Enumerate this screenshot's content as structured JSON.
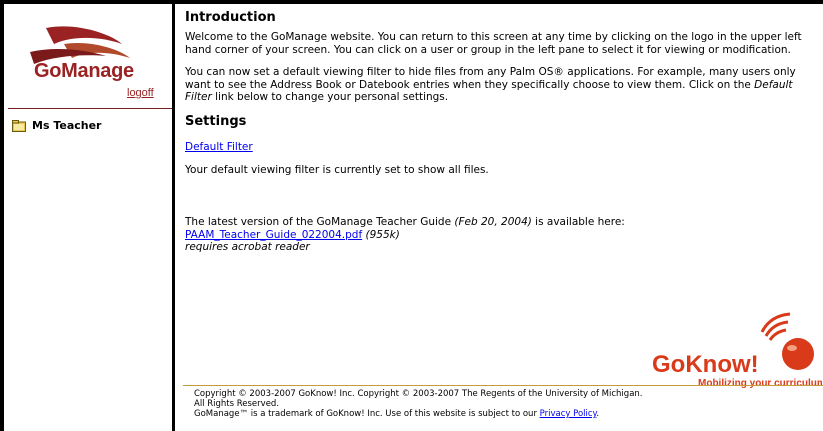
{
  "sidebar": {
    "logo_text": "GoManage",
    "logoff_label": "logoff",
    "user_label": "Ms Teacher"
  },
  "intro": {
    "heading": "Introduction",
    "para1": "Welcome to the GoManage website. You can return to this screen at any time by clicking on the logo in the upper left hand corner of your screen. You can click on a user or group in the left pane to select it for viewing or modification.",
    "para2_start": "You can now set a default viewing filter to hide files from any Palm OS® applications. For example, many users only want to see the Address Book or Datebook entries when they specifically choose to view them. Click on the ",
    "para2_em": "Default Filter",
    "para2_end": " link below to change your personal settings."
  },
  "settings": {
    "heading": "Settings",
    "filter_link": "Default Filter",
    "filter_status": "Your default viewing filter is currently set to show all files."
  },
  "guide": {
    "text_start": "The latest version of the GoManage Teacher Guide ",
    "text_date": "(Feb 20, 2004)",
    "text_end": " is available here:",
    "pdf_link": "PAAM_Teacher_Guide_022004.pdf",
    "pdf_size": "(955k)",
    "requirement": "requires acrobat reader"
  },
  "brand": {
    "gk_text": "GoKnow!",
    "gk_tagline": "Mobilizing your curriculum"
  },
  "footer": {
    "line1": "Copyright © 2003-2007 GoKnow! Inc. Copyright © 2003-2007 The Regents of the University of Michigan.",
    "line2": "All Rights Reserved.",
    "line3_start": "GoManage™ is a trademark of GoKnow! Inc. Use of this website is subject to our ",
    "privacy_link": "Privacy Policy",
    "line3_end": "."
  },
  "colors": {
    "brand_red": "#9b2222",
    "link_blue": "#0000ee",
    "rule_gold": "#c89b3a"
  }
}
